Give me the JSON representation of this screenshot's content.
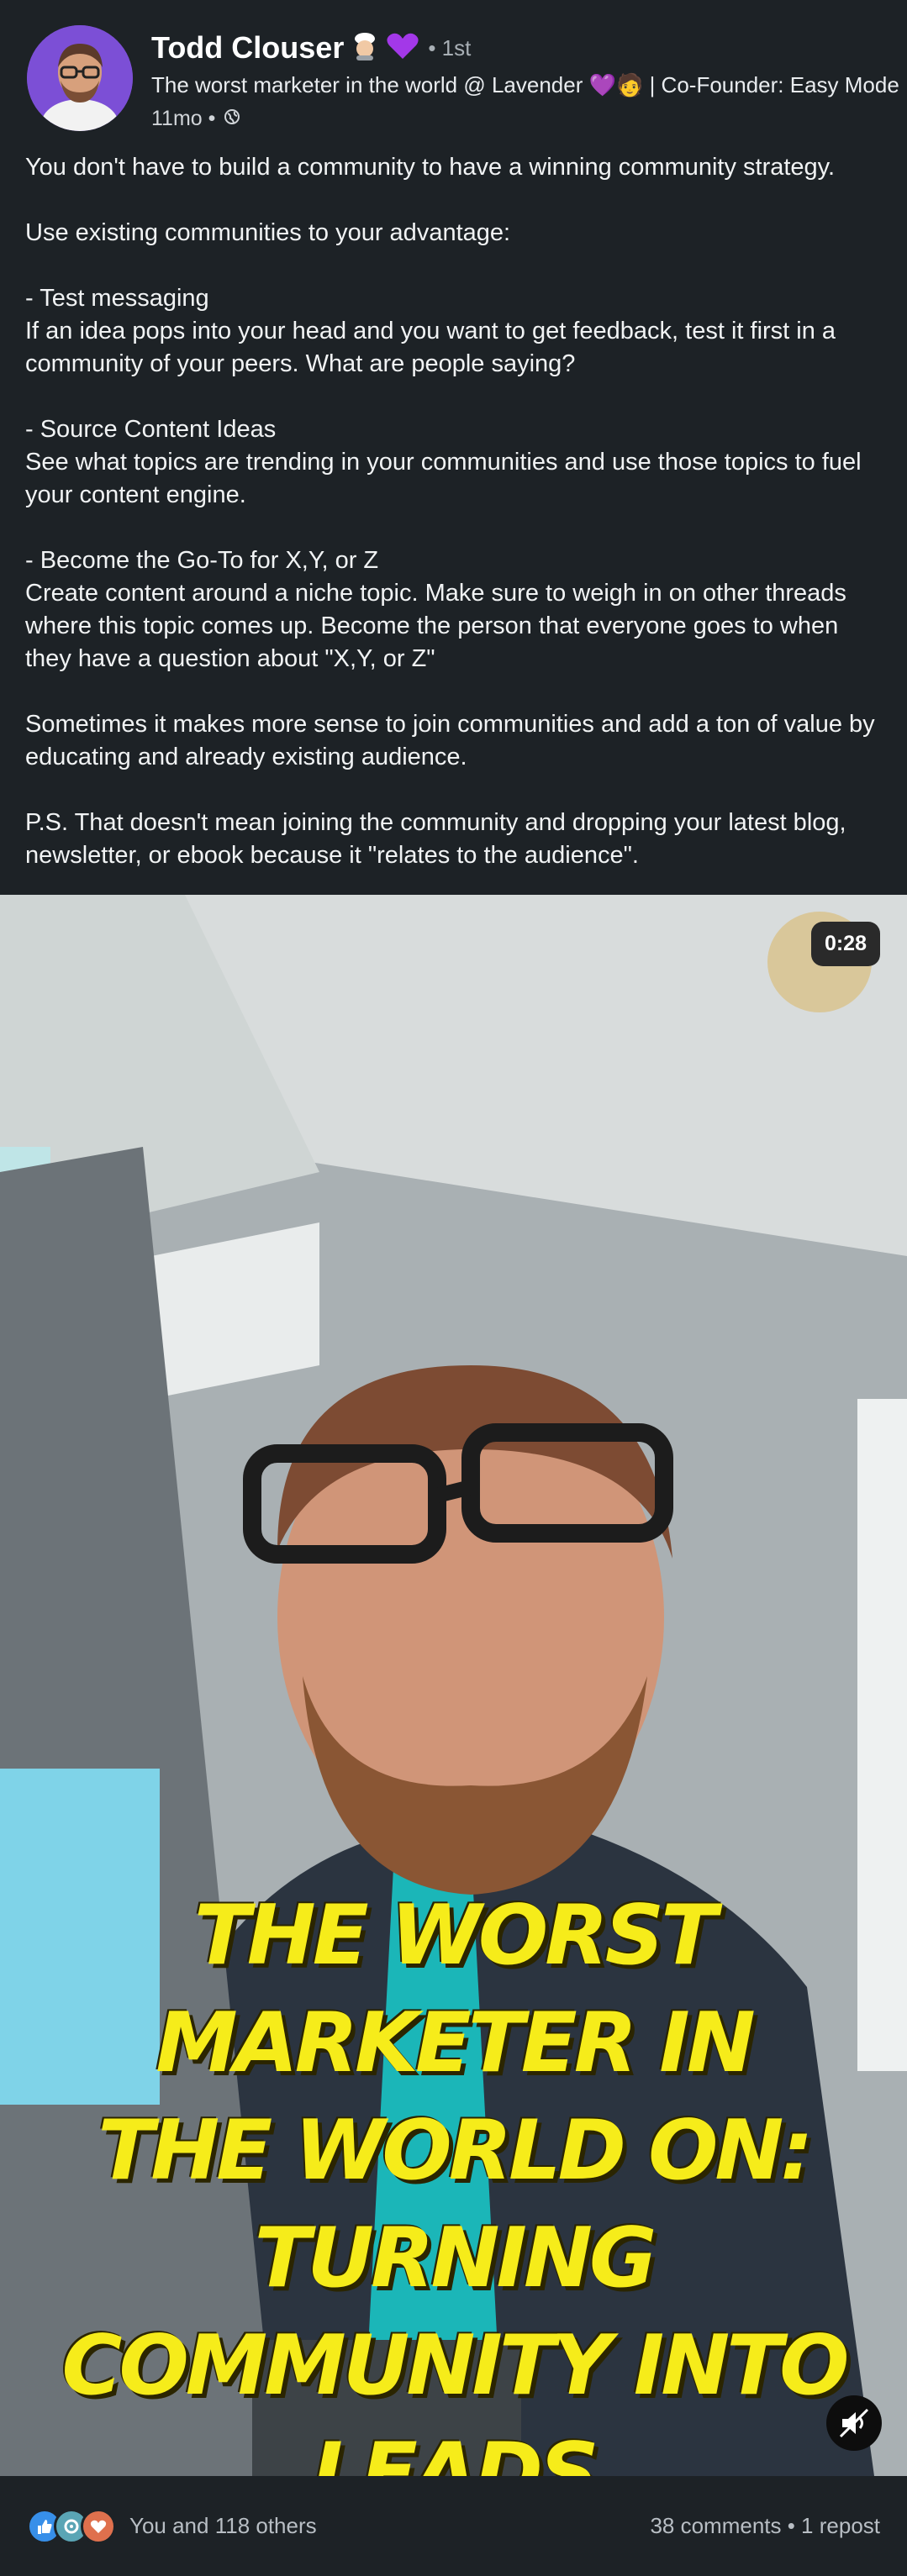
{
  "author": {
    "name": "Todd Clouser",
    "degree": "• 1st",
    "headline": "The worst marketer in the world @ Lavender 💜🧑 | Co-Founder: Easy Mode",
    "timestamp": "11mo •",
    "visibility_icon": "globe-icon"
  },
  "post": {
    "paragraphs": [
      "You don't have to build a community to have a winning community strategy.",
      "Use existing communities to your advantage:",
      "- Test messaging\nIf an idea pops into your head and you want to get feedback, test it first in a community of your peers. What are people saying?",
      "- Source Content Ideas\nSee what topics are trending in your communities and use those topics to fuel your content engine.",
      "- Become the Go-To for X,Y, or Z\nCreate content around a niche topic. Make sure to weigh in on other threads where this topic comes up. Become the person that everyone goes to when they have a question about \"X,Y, or Z\"",
      "Sometimes it makes more sense to join communities and add a ton of value by educating and already existing audience.",
      "P.S. That doesn't mean joining the community and dropping your latest blog, newsletter, or ebook because it \"relates to the audience\"."
    ]
  },
  "video": {
    "duration": "0:28",
    "caption_lines": [
      "THE WORST MARKETER IN",
      "THE WORLD ON: TURNING",
      "COMMUNITY INTO LEADS"
    ],
    "mute_icon": "muted-speaker-icon"
  },
  "social": {
    "reaction_icons": [
      "like-icon",
      "celebrate-icon",
      "love-icon"
    ],
    "reactions_text": "You and 118 others",
    "counts_text": "38 comments • 1 repost"
  },
  "colors": {
    "background": "#1d2226",
    "caption_yellow": "#f6ec1a",
    "avatar_ring": "#7c4fd6",
    "like_blue": "#378fe9",
    "love_red": "#df704d"
  }
}
